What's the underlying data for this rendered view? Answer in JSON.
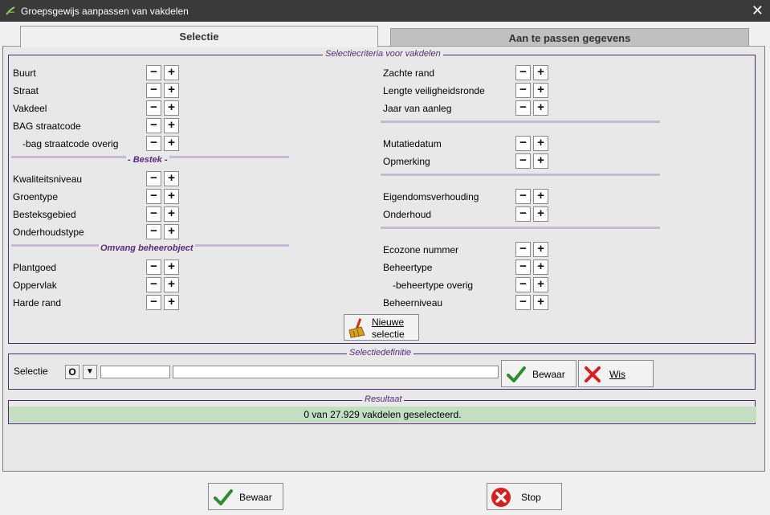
{
  "window": {
    "title": "Groepsgewijs aanpassen van vakdelen",
    "close_glyph": "✕"
  },
  "tabs": [
    {
      "label": "Selectie",
      "active": true
    },
    {
      "label": "Aan te passen gegevens",
      "active": false
    }
  ],
  "criteria": {
    "legend": "Selectiecriteria voor vakdelen",
    "left_items": [
      "Buurt",
      "Straat",
      "Vakdeel",
      "BAG straatcode",
      "-bag straatcode overig"
    ],
    "bestek_heading": "- Bestek -",
    "bestek_items": [
      "Kwaliteitsniveau",
      "Groentype",
      "Besteksgebied",
      "Onderhoudstype"
    ],
    "omvang_heading": "Omvang beheerobject",
    "omvang_items": [
      "Plantgoed",
      "Oppervlak",
      "Harde rand"
    ],
    "right_items_a": [
      "Zachte rand",
      "Lengte veiligheidsronde",
      "Jaar van aanleg"
    ],
    "right_items_b": [
      "Mutatiedatum",
      "Opmerking"
    ],
    "right_items_c": [
      "Eigendomsverhouding",
      "Onderhoud"
    ],
    "right_items_d": [
      "Ecozone nummer",
      "Beheertype",
      "-beheertype overig",
      "Beheerniveau"
    ],
    "minus": "−",
    "plus": "+",
    "new_selection_line1": "Nieuwe",
    "new_selection_line2": "selectie"
  },
  "definitie": {
    "legend": "Selectiedefinitie",
    "label": "Selectie",
    "o_button": "O",
    "dropdown": "▼",
    "save": "Bewaar",
    "clear": "Wis"
  },
  "resultaat": {
    "legend": "Resultaat",
    "text": "0 van 27.929 vakdelen geselecteerd."
  },
  "footer": {
    "save": "Bewaar",
    "stop": "Stop"
  },
  "colors": {
    "group_border": "#4a2a6a",
    "legend_text": "#5a2a7a",
    "status_bg": "#c4dec4",
    "check_green": "#2e8b2e",
    "cross_red": "#d42020"
  }
}
